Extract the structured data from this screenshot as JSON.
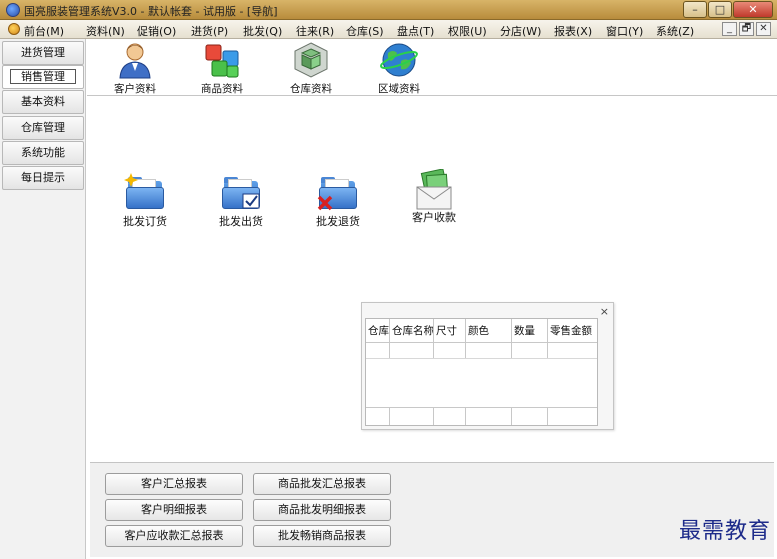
{
  "window": {
    "title": "国亮服装管理系统V3.0 - 默认帐套 - 试用版 - [导航]",
    "minimize": "–",
    "maximize": "□",
    "close": "✕"
  },
  "menu": {
    "items": [
      "前台(M)",
      "资料(N)",
      "促销(O)",
      "进货(P)",
      "批发(Q)",
      "往来(R)",
      "仓库(S)",
      "盘点(T)",
      "权限(U)",
      "分店(W)",
      "报表(X)",
      "窗口(Y)",
      "系统(Z)"
    ],
    "mdi_min": "_",
    "mdi_restore": "🗗",
    "mdi_close": "✕"
  },
  "sidebar": {
    "tabs": [
      "进货管理",
      "销售管理",
      "基本资料",
      "仓库管理",
      "系统功能",
      "每日提示"
    ],
    "active": "销售管理"
  },
  "toolbar": {
    "items": [
      {
        "label": "客户资料",
        "icon": "customer-person-icon"
      },
      {
        "label": "商品资料",
        "icon": "product-cubes-icon"
      },
      {
        "label": "仓库资料",
        "icon": "warehouse-boxes-icon"
      },
      {
        "label": "区域资料",
        "icon": "globe-icon"
      }
    ]
  },
  "actions": [
    {
      "label": "批发订货",
      "icon": "folder-order-icon"
    },
    {
      "label": "批发出货",
      "icon": "folder-check-icon"
    },
    {
      "label": "批发退货",
      "icon": "folder-return-icon"
    },
    {
      "label": "客户收款",
      "icon": "envelope-money-icon"
    }
  ],
  "panel": {
    "close": "×",
    "columns": [
      "仓库",
      "仓库名称",
      "尺寸",
      "颜色",
      "数量",
      "零售金额"
    ]
  },
  "reports": {
    "left": [
      "客户汇总报表",
      "客户明细报表",
      "客户应收款汇总报表"
    ],
    "right": [
      "商品批发汇总报表",
      "商品批发明细报表",
      "批发畅销商品报表"
    ]
  },
  "watermark": "最需教育",
  "colors": {
    "titlebar": "#c9a455",
    "close": "#c0392b",
    "watermark": "#1d2b8a"
  }
}
